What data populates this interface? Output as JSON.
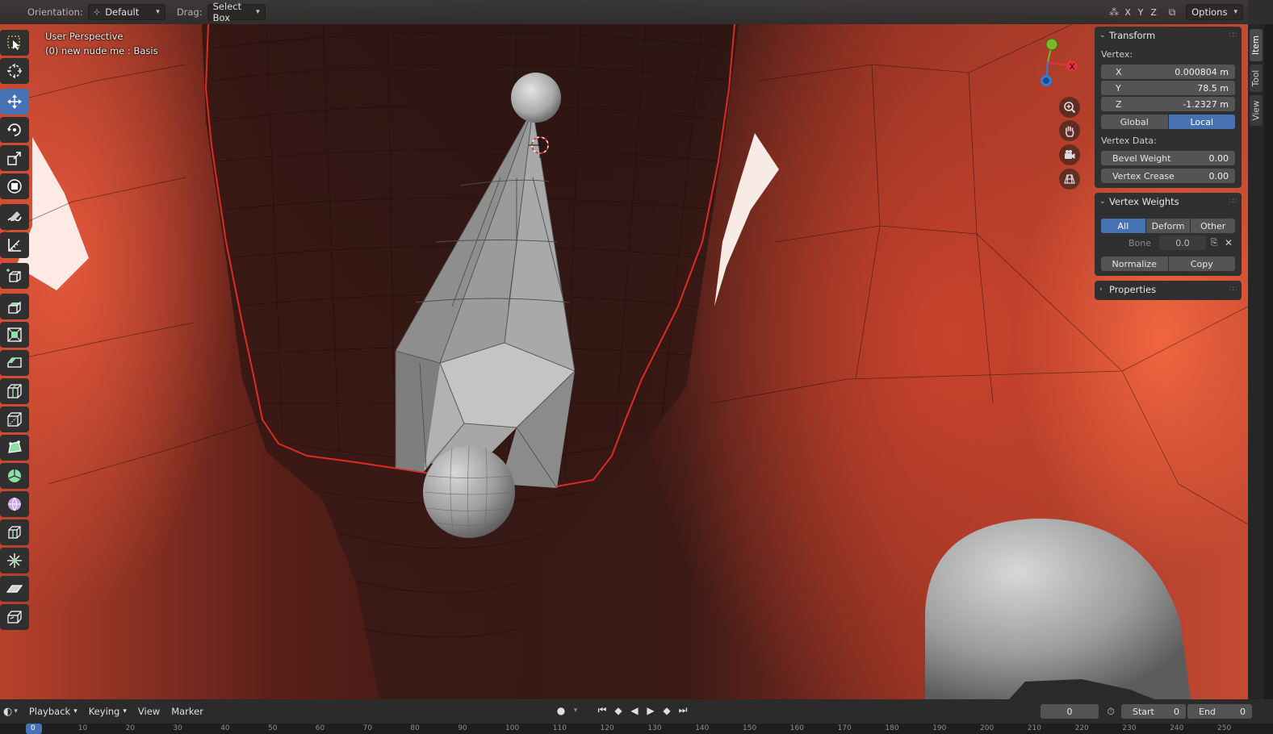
{
  "header": {
    "orientation_label": "Orientation:",
    "orientation_value": "Default",
    "drag_label": "Drag:",
    "drag_value": "Select Box",
    "axis_x": "X",
    "axis_y": "Y",
    "axis_z": "Z",
    "options_label": "Options"
  },
  "viewport": {
    "perspective": "User Perspective",
    "object_info": "(0) new nude me : Basis"
  },
  "gizmo": {
    "x_label": "X"
  },
  "toolbar": {
    "tools": [
      "select-box",
      "cursor",
      "move",
      "rotate",
      "scale",
      "transform",
      "annotate",
      "measure",
      "add-cube",
      "extrude-region",
      "inset-faces",
      "bevel",
      "loop-cut",
      "knife",
      "poly-build",
      "spin",
      "smooth",
      "edge-slide",
      "shrink-fatten",
      "shear",
      "rip-region"
    ],
    "active": "move"
  },
  "sidebar": {
    "transform": {
      "title": "Transform",
      "vertex_label": "Vertex:",
      "x_label": "X",
      "x_value": "0.000804 m",
      "y_label": "Y",
      "y_value": "78.5 m",
      "z_label": "Z",
      "z_value": "-1.2327 m",
      "global_label": "Global",
      "local_label": "Local",
      "active_space": "Local",
      "vertex_data_label": "Vertex Data:",
      "bevel_weight_label": "Bevel Weight",
      "bevel_weight_value": "0.00",
      "vertex_crease_label": "Vertex Crease",
      "vertex_crease_value": "0.00"
    },
    "vertex_weights": {
      "title": "Vertex Weights",
      "all_label": "All",
      "deform_label": "Deform",
      "other_label": "Other",
      "active_filter": "All",
      "bone_label": "Bone",
      "bone_value": "0.0",
      "normalize_label": "Normalize",
      "copy_label": "Copy"
    },
    "properties": {
      "title": "Properties"
    }
  },
  "side_tabs": {
    "item": "Item",
    "tool": "Tool",
    "view": "View",
    "active": "Item"
  },
  "timeline": {
    "playback_label": "Playback",
    "keying_label": "Keying",
    "view_label": "View",
    "marker_label": "Marker",
    "current_frame": "0",
    "start_label": "Start",
    "start_value": "0",
    "end_label": "End",
    "end_value": "0",
    "ruler_ticks": [
      "0",
      "10",
      "20",
      "30",
      "40",
      "50",
      "60",
      "70",
      "80",
      "90",
      "100",
      "110",
      "120",
      "130",
      "140",
      "150",
      "160",
      "170",
      "180",
      "190",
      "200",
      "210",
      "220",
      "230",
      "240",
      "250"
    ]
  },
  "colors": {
    "accent": "#4772b3",
    "panel": "#303030",
    "field": "#545454",
    "selection_outline": "#e02a1f"
  }
}
